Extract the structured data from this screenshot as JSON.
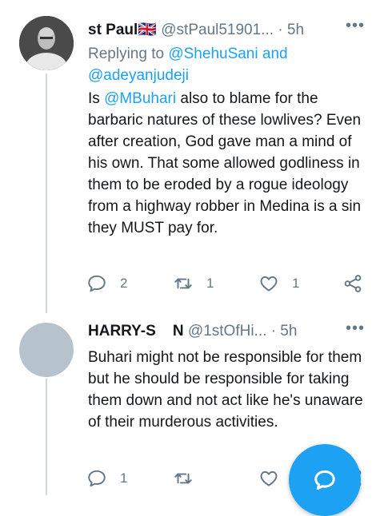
{
  "tweets": [
    {
      "name": "st Paul",
      "flag": "🇬🇧",
      "handle": "@stPaul51901...",
      "separator": "·",
      "time": "5h",
      "more": "•••",
      "replying_prefix": "Replying to",
      "replying_user1": "@ShehuSani",
      "replying_and": "and",
      "replying_user2": "@adeyanjudeji",
      "body_lead": "Is",
      "body_mention": "@MBuhari",
      "body_rest": "also to blame for the barbaric natures of these lowlives? Even after creation, God gave man a mind of his own. That some allowed godliness in them to be eroded by a rogue ideology from a highway robber in Medina is a sin they MUST pay for.",
      "reply_count": "2",
      "retweet_count": "1",
      "like_count": "1",
      "avatar_color": "#3a3a3a"
    },
    {
      "name": "HARRY-S    N",
      "handle": "@1stOfHi...",
      "separator": "·",
      "time": "5h",
      "more": "•••",
      "body": "Buhari might not be responsible for them but he should be responsible for taking them down and not act like he's unaware of their murderous activities.",
      "reply_count": "1",
      "avatar_color": "#b7c3cc"
    }
  ],
  "icons": {
    "reply": "reply-icon",
    "retweet": "retweet-icon",
    "like": "like-icon",
    "share": "share-icon",
    "compose": "compose-reply-icon"
  },
  "colors": {
    "accent": "#1da1f2",
    "muted": "#657786",
    "text": "#14171a",
    "thread_line": "#ccd6dd"
  }
}
